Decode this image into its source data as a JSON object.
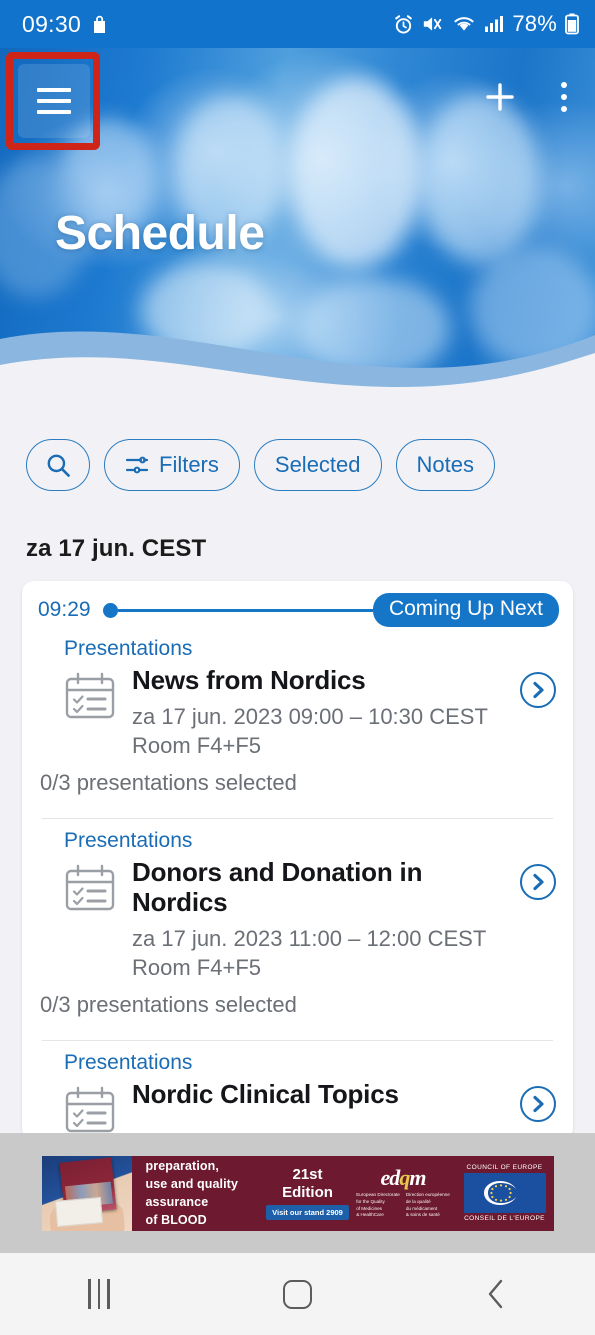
{
  "status_bar": {
    "clock": "09:30",
    "battery_text": "78%",
    "icons": [
      "bag-icon",
      "alarm-icon",
      "mute-vibrate-icon",
      "wifi-icon",
      "signal-icon",
      "battery-icon"
    ]
  },
  "top_bar": {
    "menu_icon": "hamburger-menu-icon",
    "add_icon": "plus-icon",
    "overflow_icon": "kebab-menu-icon",
    "highlight_color": "#cf2418"
  },
  "hero": {
    "title": "Schedule",
    "accent_color": "#1576c8"
  },
  "toolbar": {
    "search_label": "",
    "search_icon": "search-icon",
    "filters_label": "Filters",
    "filters_icon": "sliders-icon",
    "selected_label": "Selected",
    "notes_label": "Notes"
  },
  "schedule": {
    "day_heading": "za 17 jun. CEST",
    "timeline": {
      "time": "09:29",
      "badge": "Coming Up Next"
    },
    "sessions": [
      {
        "kicker": "Presentations",
        "title": "News from Nordics",
        "meta": "za 17 jun. 2023 09:00 – 10:30 CEST",
        "room": "Room F4+F5",
        "count": "0/3 presentations selected",
        "icon": "calendar-checklist-icon",
        "chevron": "chevron-right-circle-icon"
      },
      {
        "kicker": "Presentations",
        "title": "Donors and Donation in Nordics",
        "meta": "za 17 jun. 2023 11:00 – 12:00 CEST",
        "room": "Room F4+F5",
        "count": "0/3 presentations selected",
        "icon": "calendar-checklist-icon",
        "chevron": "chevron-right-circle-icon"
      },
      {
        "kicker": "Presentations",
        "title": "Nordic Clinical Topics",
        "meta": "",
        "room": "",
        "count": "",
        "icon": "calendar-checklist-icon",
        "chevron": "chevron-right-circle-icon"
      }
    ]
  },
  "ad_banner": {
    "line1": "Guide to the preparation,",
    "line2": "use and quality assurance",
    "line3": "of BLOOD COMPONENTS",
    "edition_number": "21st",
    "edition_word": "Edition",
    "stand_label": "Visit our stand 2909",
    "edqm_mark": "edqm",
    "edqm_sub_left": "European Directorate\nfor the Quality\nof Medicines\n& HealthCare",
    "edqm_sub_right": "Direction européenne\nde la qualité\ndu médicament\n& soins de santé",
    "coe_top": "COUNCIL OF EUROPE",
    "coe_bottom": "CONSEIL DE L'EUROPE",
    "background_color": "#6d1a30"
  },
  "nav_bar": {
    "recents_label": "recents-icon",
    "home_label": "home-icon",
    "back_label": "back-icon"
  }
}
